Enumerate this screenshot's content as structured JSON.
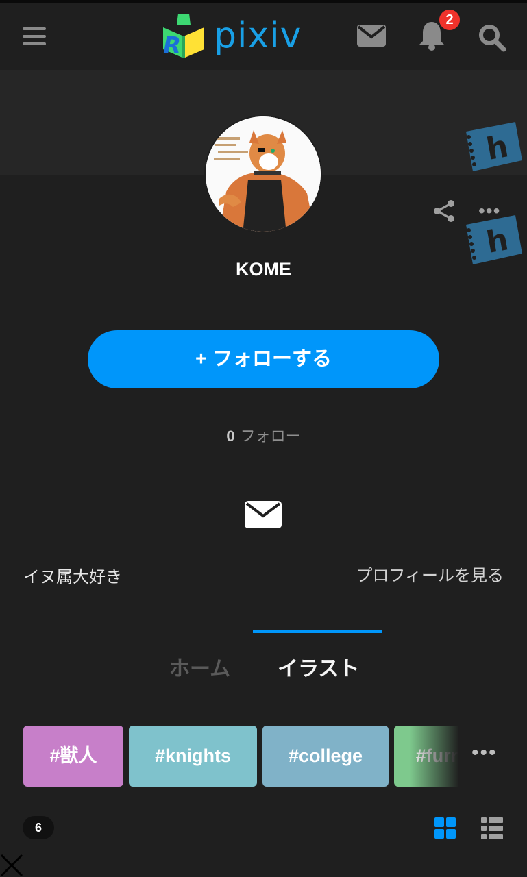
{
  "header": {
    "logo_text": "pixiv",
    "notification_count": "2"
  },
  "profile": {
    "username": "KOME",
    "follow_button_label": "+ フォローする",
    "following_count": "0",
    "following_label": "フォロー",
    "bio": "イヌ属大好き",
    "profile_link": "プロフィールを見る"
  },
  "tabs": [
    {
      "label": "ホーム",
      "active": false
    },
    {
      "label": "イラスト",
      "active": true
    }
  ],
  "tags": [
    {
      "label": "#獣人",
      "color": "#c77fc9"
    },
    {
      "label": "#knights",
      "color": "#7fc2cc"
    },
    {
      "label": "#college",
      "color": "#80b2c8"
    },
    {
      "label": "#furry",
      "color": "#7ec98d"
    }
  ],
  "works_count": "6",
  "colors": {
    "accent": "#0096fa",
    "background": "#1f1f1f",
    "badge": "#f0322b"
  }
}
